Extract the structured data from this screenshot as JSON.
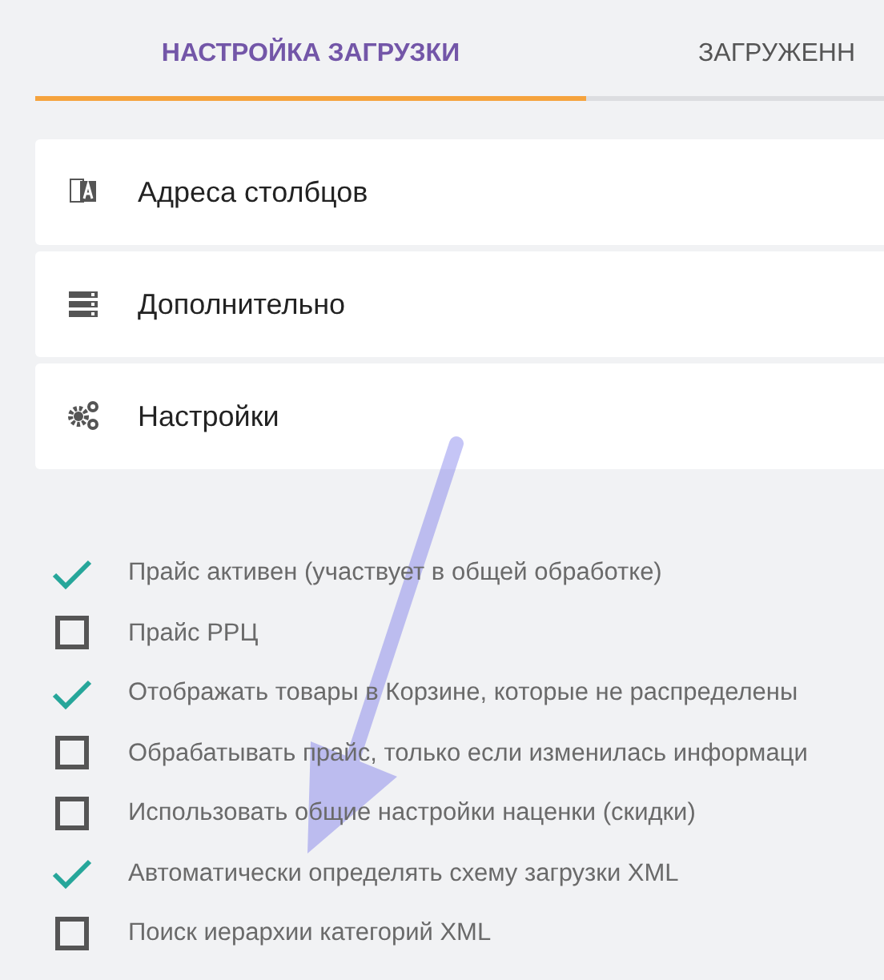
{
  "tabs": [
    {
      "label": "НАСТРОЙКА ЗАГРУЗКИ",
      "selected": true
    },
    {
      "label": "ЗАГРУЖЕНН",
      "selected": false
    }
  ],
  "sections": [
    {
      "kind": "columns",
      "label": "Адреса столбцов"
    },
    {
      "kind": "extra",
      "label": "Дополнительно"
    },
    {
      "kind": "settings",
      "label": "Настройки"
    }
  ],
  "options": [
    {
      "label": "Прайс активен (участвует в общей обработке)",
      "checked": true
    },
    {
      "label": "Прайс РРЦ",
      "checked": false
    },
    {
      "label": "Отображать товары в Корзине, которые не распределены",
      "checked": true
    },
    {
      "label": "Обрабатывать прайс, только если изменилась информаци",
      "checked": false
    },
    {
      "label": "Использовать общие настройки наценки (скидки)",
      "checked": false
    },
    {
      "label": "Автоматически определять схему загрузки XML",
      "checked": true
    },
    {
      "label": "Поиск иерархии категорий XML",
      "checked": false
    }
  ]
}
